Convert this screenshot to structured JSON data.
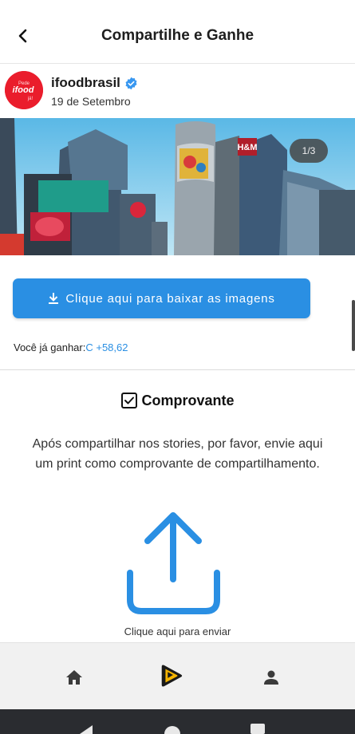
{
  "appbar": {
    "title": "Compartilhe e Ganhe",
    "back_icon": "chevron-left-icon"
  },
  "post": {
    "username": "ifoodbrasil",
    "verified_icon": "verified-badge-icon",
    "date": "19 de Setembro",
    "avatar_brand_color": "#ea1d2c",
    "avatar_text_top": "Pede",
    "avatar_text_main": "ifood",
    "avatar_text_bottom": "já!"
  },
  "carousel": {
    "page_indicator": "1/3",
    "sign_text": "H&M"
  },
  "download": {
    "label": "Clique aqui para baixar as imagens",
    "icon": "download-icon",
    "color": "#2a8fe3"
  },
  "earnings": {
    "label": "Você já ganhar:",
    "value": "C +58,62",
    "value_color": "#2a8fe3"
  },
  "proof": {
    "checkbox_icon": "checkbox-checked-icon",
    "title": "Comprovante",
    "description": "Após compartilhar nos stories, por favor, envie aqui um print como comprovante de compartilhamento.",
    "upload_icon": "share-upload-icon",
    "upload_caption": "Clique aqui para enviar",
    "upload_color": "#2a8fe3"
  },
  "bottom_nav": {
    "items": [
      {
        "icon": "home-icon"
      },
      {
        "icon": "app-logo-icon"
      },
      {
        "icon": "profile-icon"
      }
    ]
  },
  "system_nav": {
    "buttons": [
      "back-triangle-icon",
      "home-circle-icon",
      "recents-square-icon"
    ]
  }
}
